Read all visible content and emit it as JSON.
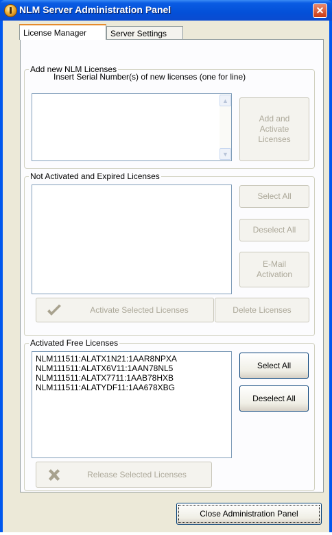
{
  "window": {
    "title": "NLM Server Administration Panel"
  },
  "tabs": [
    "License Manager",
    "Server Settings"
  ],
  "add_group": {
    "label": "Add new NLM Licenses",
    "instruction": "Insert Serial Number(s) of new licenses (one for line)",
    "serials_value": "",
    "add_button": [
      "Add and",
      "Activate",
      "Licenses"
    ]
  },
  "not_activated_group": {
    "label": "Not Activated and Expired Licenses",
    "items": [],
    "select_all": "Select All",
    "deselect_all": "Deselect All",
    "email_activation": [
      "E-Mail",
      "Activation"
    ],
    "activate_selected": "Activate Selected Licenses",
    "delete_licenses": "Delete Licenses"
  },
  "activated_group": {
    "label": "Activated Free Licenses",
    "items": [
      "NLM111511:ALATX1N21:1AAR8NPXA",
      "NLM111511:ALATX6V11:1AAN78NL5",
      "NLM111511:ALATX7711:1AAB78HXB",
      "NLM111511:ALATYDF11:1AA678XBG"
    ],
    "select_all": "Select All",
    "deselect_all": "Deselect All",
    "release_selected": "Release Selected Licenses"
  },
  "footer": {
    "close_button": "Close Administration Panel"
  },
  "colors": {
    "titlebar": "#0a5ce3",
    "dialog_bg": "#ece9d8",
    "close_red": "#cc3a12",
    "tab_highlight": "#e68b2c"
  },
  "icons": {
    "app": "nlm-key-icon",
    "close": "close-icon",
    "activate": "checkmark-icon",
    "release": "x-mark-icon"
  }
}
